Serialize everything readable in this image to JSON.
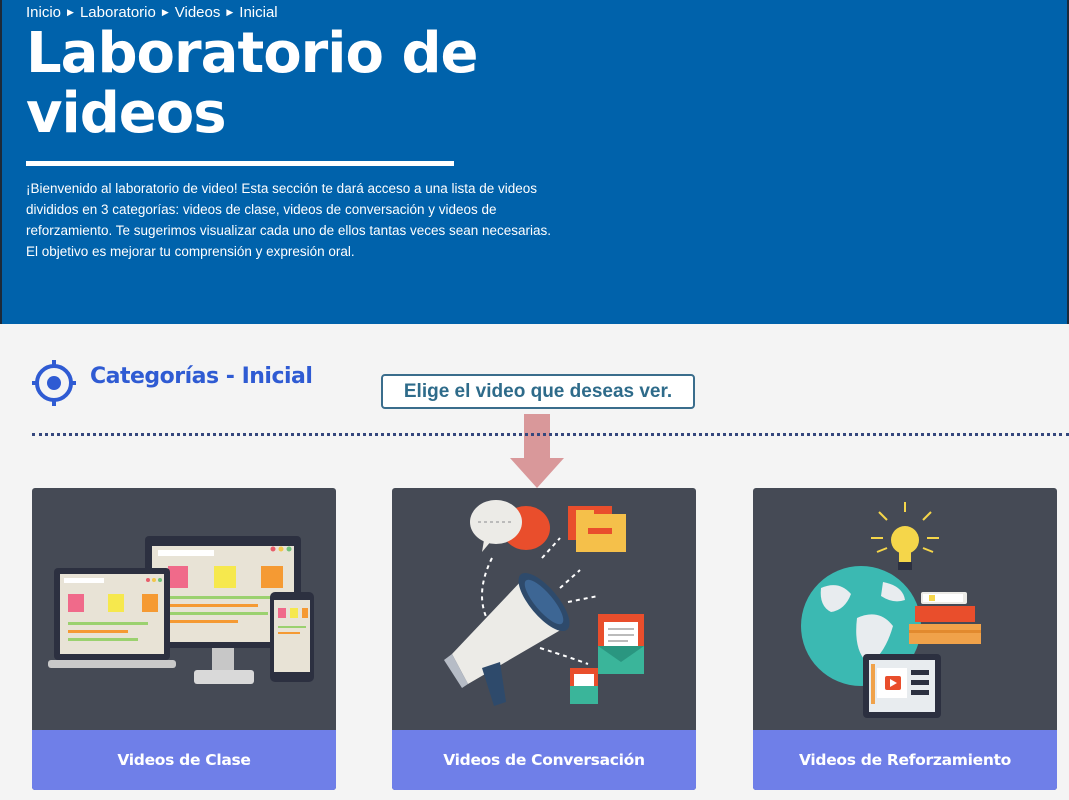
{
  "breadcrumb": [
    "Inicio",
    "Laboratorio",
    "Videos",
    "Inicial"
  ],
  "hero": {
    "title": "Laboratorio de videos",
    "intro": "¡Bienvenido al laboratorio de video! Esta sección te dará acceso a una lista de videos divididos en 3 categorías: videos de clase, videos de conversación y videos de reforzamiento. Te sugerimos visualizar cada uno de ellos tantas veces sean necesarias. El objetivo es mejorar tu comprensión y expresión oral."
  },
  "categories": {
    "title": "Categorías - Inicial",
    "icon": "target-icon"
  },
  "callout": {
    "text": "Elige el video que deseas ver."
  },
  "cards": [
    {
      "label": "Videos de Clase",
      "icon": "devices-illustration"
    },
    {
      "label": "Videos de Conversación",
      "icon": "megaphone-illustration"
    },
    {
      "label": "Videos de Reforzamiento",
      "icon": "globe-books-illustration"
    }
  ],
  "colors": {
    "hero_bg": "#0062ab",
    "card_bg": "#454a55",
    "card_label_bg": "#6f7fe8",
    "accent_blue": "#2f5bd3",
    "arrow": "#d9989a"
  }
}
